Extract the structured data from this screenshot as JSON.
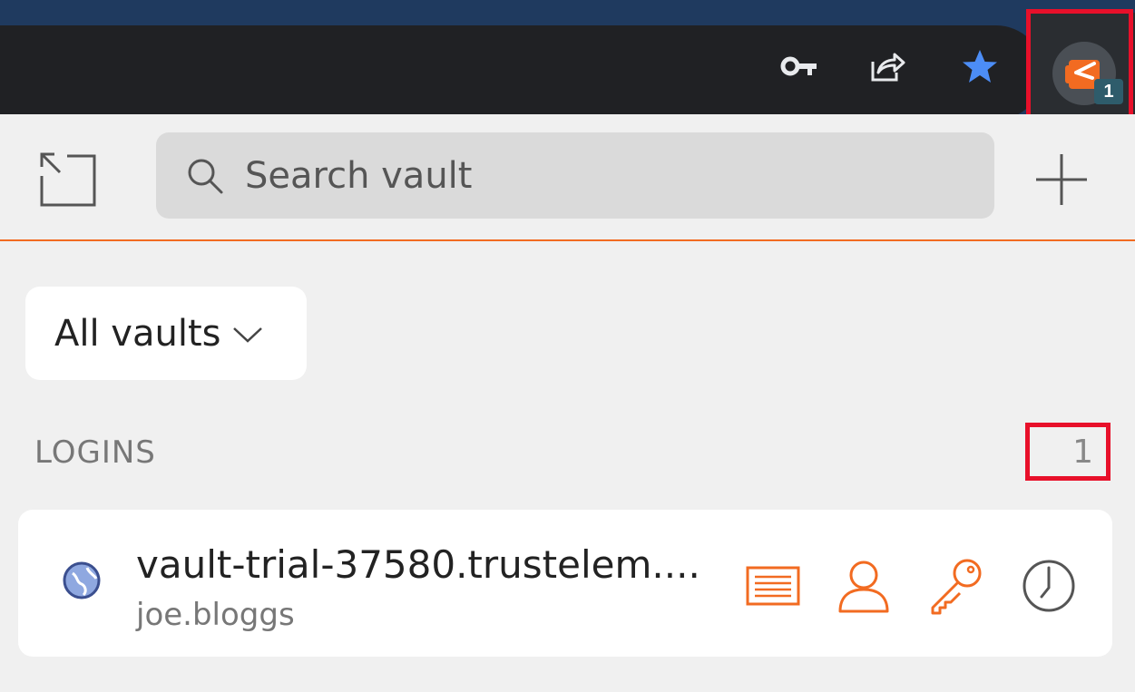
{
  "toolbar": {
    "icons": [
      "key-icon",
      "share-icon",
      "star-icon"
    ],
    "extension": {
      "icon": "trustelem-extension-icon",
      "badge": "1",
      "accent": "#f26b21"
    }
  },
  "header": {
    "popout_icon": "popout-icon",
    "search": {
      "placeholder": "Search vault",
      "value": ""
    },
    "add_icon": "plus-icon"
  },
  "vault_filter": {
    "selected": "All vaults",
    "icon": "chevron-down-icon"
  },
  "logins": {
    "title": "LOGINS",
    "count": "1",
    "items": [
      {
        "title": "vault-trial-37580.trustelem....",
        "username": "joe.bloggs",
        "icon": "globe-icon",
        "actions": [
          "details-icon",
          "user-icon",
          "password-icon",
          "history-icon"
        ]
      }
    ]
  },
  "colors": {
    "accent": "#f26b21",
    "highlight": "#e8102a",
    "toolbar": "#202124"
  }
}
